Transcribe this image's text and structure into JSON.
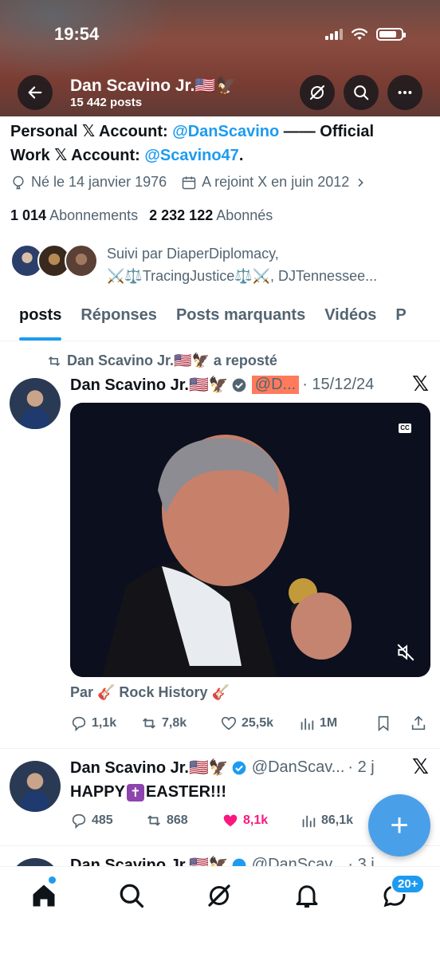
{
  "status_bar": {
    "time": "19:54"
  },
  "header": {
    "name": "Dan Scavino Jr.🇺🇸🦅",
    "post_count": "15 442 posts"
  },
  "bio": {
    "line1_prefix": "Personal ",
    "x_symbol": "𝕏",
    "line1_mid": " Account: ",
    "handle1": "@DanScavino",
    "line1_suffix": " —— Official",
    "line2_prefix": "Work ",
    "line2_mid": " Account: ",
    "handle2": "@Scavino47",
    "line2_suffix": "."
  },
  "meta": {
    "birth": "Né le 14 janvier 1976",
    "joined": "A rejoint X en juin 2012"
  },
  "follow_stats": {
    "following_count": "1 014",
    "following_label": "Abonnements",
    "followers_count": "2 232 122",
    "followers_label": "Abonnés"
  },
  "followed_by": {
    "line1": "Suivi par DiaperDiplomacy,",
    "line2": "⚔️⚖️TracingJustice⚖️⚔️, DJTennessee..."
  },
  "tabs": [
    {
      "label": "posts",
      "active": true
    },
    {
      "label": "Réponses",
      "active": false
    },
    {
      "label": "Posts marquants",
      "active": false
    },
    {
      "label": "Vidéos",
      "active": false
    },
    {
      "label": "P",
      "active": false
    }
  ],
  "posts": [
    {
      "repost_by": "Dan Scavino Jr.🇺🇸🦅 a reposté",
      "name": "Dan Scavino Jr.🇺🇸🦅",
      "handle": "@D...",
      "date": "· 15/12/24",
      "attribution": "Par 🎸 Rock History 🎸",
      "replies": "1,1k",
      "reposts": "7,8k",
      "likes": "25,5k",
      "views": "1M"
    },
    {
      "name": "Dan Scavino Jr.🇺🇸🦅",
      "handle": "@DanScav...",
      "date": "· 2 j",
      "text_before": "HAPPY",
      "text_cross": "✝",
      "text_after": "EASTER!!!",
      "replies": "485",
      "reposts": "868",
      "likes": "8,1k",
      "views": "86,1k"
    },
    {
      "name": "Dan Scavino Jr.🇺🇸🦅",
      "handle": "@DanScav...",
      "date": "· 3 j"
    }
  ],
  "video": {
    "cc_label": "CC"
  },
  "fab": {
    "label": "+"
  },
  "bottom_nav": {
    "badge": "20+"
  },
  "colors": {
    "accent": "#1d9bf0",
    "like_active": "#f91880",
    "highlight": "#ff7b5c"
  }
}
